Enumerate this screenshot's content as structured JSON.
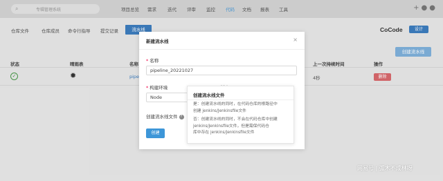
{
  "topnav": {
    "search_placeholder": "专辑管理系统",
    "links": [
      "项目总览",
      "需求",
      "迭代",
      "评审",
      "监控",
      "代码",
      "文档",
      "报表",
      "工具"
    ],
    "active_index": 5,
    "right_icons": [
      "plus-icon",
      "help-icon",
      "avatar-icon"
    ]
  },
  "subnav": {
    "links": [
      "仓库文件",
      "仓库成员",
      "命令行指导",
      "提交记录"
    ],
    "active_tab": "流水线",
    "brand": "CoCode",
    "brand_button": "设计"
  },
  "toolbar": {
    "create_label": "创建流水线"
  },
  "table": {
    "headers": {
      "status": "状态",
      "weather": "晴雨表",
      "name": "名称",
      "duration": "上一次持续时间",
      "actions": "操作"
    },
    "rows": [
      {
        "status_icon": "check-circle-icon",
        "weather_icon": "sun-icon",
        "name": "pipel",
        "duration": "4秒",
        "delete_label": "删除"
      }
    ]
  },
  "modal": {
    "title": "新建流水线",
    "close_glyph": "×",
    "name_label": "名称",
    "name_value": "pipeline_20221027",
    "env_label": "构建环境",
    "env_value": "Node",
    "version_label": "版本",
    "file_label": "创建流水线文件",
    "submit_label": "创建"
  },
  "tooltip": {
    "title": "创建流水线文件",
    "line1": "是：创建流水线的同时，在代码仓库的根路径中",
    "line2": "创建 jenkins/Jenkinsfile文件",
    "line3": "否：创建流水线的同时，不会在代码仓库中创建",
    "line4": "jenkins/Jenkinsfile文件，但是需保代码仓",
    "line5": "库中存在 jenkins/Jenkinsfile文件"
  },
  "watermark": "网易号 | 弧木不成林呀",
  "colors": {
    "accent": "#3d7dbf",
    "active_nav": "#4a9ad8",
    "delete": "#d9696d",
    "success": "#4a9a4a"
  }
}
